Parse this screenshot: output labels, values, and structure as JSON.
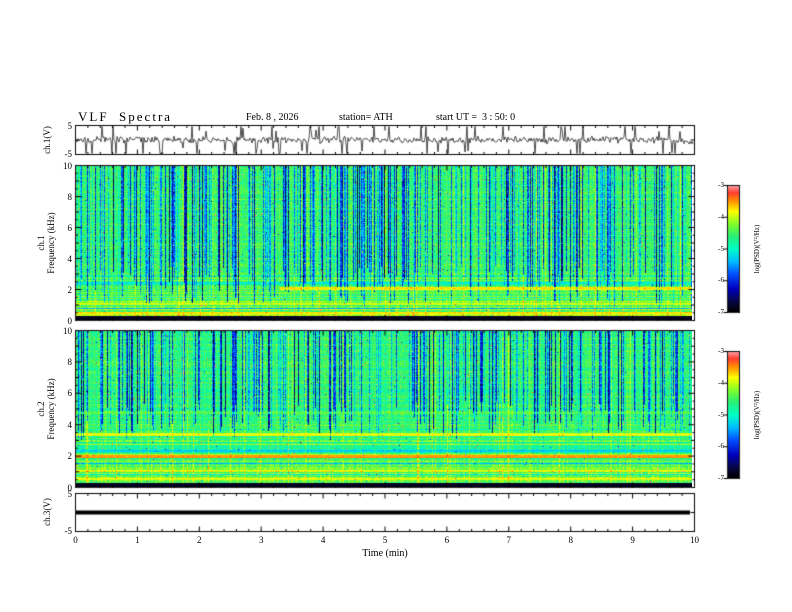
{
  "header": {
    "title": "VLF  Spectra",
    "date": "Feb. 8 , 2026",
    "station": "station= ATH",
    "start_ut": "start UT =  3 : 50: 0"
  },
  "panels": {
    "ch1_waveform": {
      "label": "ch.1(V)",
      "ymax_label": "5",
      "ymin_label": "-5"
    },
    "ch1_spectrogram": {
      "channel_label": "ch.1",
      "axis_label": "Frequency (kHz)",
      "yticks": [
        "10",
        "8",
        "6",
        "4",
        "2",
        "0"
      ]
    },
    "ch2_spectrogram": {
      "channel_label": "ch.2",
      "axis_label": "Frequency (kHz)",
      "yticks": [
        "10",
        "8",
        "6",
        "4",
        "2",
        "0"
      ]
    },
    "ch3_waveform": {
      "label": "ch.3(V)",
      "ymax_label": "5",
      "ymin_label": "-5"
    }
  },
  "colorbar": {
    "label": "log(PSD)(V²/Hz)",
    "ticks": [
      "-3",
      "-4",
      "-5",
      "-6",
      "-7"
    ]
  },
  "xaxis": {
    "label": "Time (min)",
    "ticks": [
      "0",
      "1",
      "2",
      "3",
      "4",
      "5",
      "6",
      "7",
      "8",
      "9",
      "10"
    ]
  },
  "chart_data": [
    {
      "id": "ch1_waveform",
      "type": "line",
      "ylabel": "ch.1(V)",
      "ylim": [
        -5,
        5
      ],
      "xlabel": "Time (min)",
      "xlim": [
        0,
        10
      ],
      "summary": "continuous broadband noise centered on 0 V with dense impulsive spikes reaching about ±5 V across the whole 10 minutes",
      "seed": 5,
      "noise_frac": 0.15,
      "spike_rate": 0.12
    },
    {
      "id": "ch1_spectrogram",
      "type": "heatmap",
      "xlabel": "Time (min)",
      "ylabel": "Frequency (kHz)",
      "zlabel": "log(PSD)(V²/Hz)",
      "xlim": [
        0,
        10
      ],
      "ylim": [
        0,
        10
      ],
      "zlim": [
        -7,
        -3
      ],
      "summary": "green/cyan background near -4.6 with dense dark-blue vertical sferic striations above ~1-3 kHz, scattered red speckles, yellow-orange mottling below 2.5 kHz, red horizontal lines near 0.5/1/2 kHz (the ~2 kHz line strengthens after ~3.3 min) and a black band at 0-0.25 kHz",
      "base_level": -4.55,
      "low_freq_boost": 0.22,
      "streak_density": 0.38,
      "streak_fmin": [
        0.8,
        3.5
      ],
      "stripe": 0,
      "seed": 11,
      "bands": [
        {
          "f": 0.12,
          "hw": 0.14,
          "level": -7.0,
          "s": 0.95
        },
        {
          "f": 0.45,
          "hw": 0.06,
          "level": -3.6,
          "s": 0.7
        },
        {
          "f": 0.75,
          "hw": 0.05,
          "level": -6.3,
          "s": 0.55
        },
        {
          "f": 1.05,
          "hw": 0.06,
          "level": -3.8,
          "s": 0.6
        },
        {
          "f": 1.45,
          "hw": 0.05,
          "level": -6.1,
          "s": 0.45
        },
        {
          "f": 1.8,
          "hw": 0.05,
          "level": -3.9,
          "s": 0.5
        },
        {
          "f": 2.05,
          "hw": 0.08,
          "level": -3.4,
          "s": 0.7,
          "x0": 3.3,
          "x1": 10
        },
        {
          "f": 2.4,
          "hw": 0.05,
          "level": -6.2,
          "s": 0.4
        }
      ]
    },
    {
      "id": "ch2_spectrogram",
      "type": "heatmap",
      "xlabel": "Time (min)",
      "ylabel": "Frequency (kHz)",
      "zlabel": "log(PSD)(V²/Hz)",
      "xlim": [
        0,
        10
      ],
      "ylim": [
        0,
        10
      ],
      "zlim": [
        -7,
        -3
      ],
      "summary": "similar green/cyan background with blue vertical striations mostly above ~4 kHz; lower half dominated by fine horizontal striping with strong red lines near 2 kHz, a yellow-red line near 3.35 kHz, an orange line near 4.75 kHz and a black band at 0-0.25 kHz",
      "base_level": -4.6,
      "low_freq_boost": 0.28,
      "streak_density": 0.3,
      "streak_fmin": [
        3.0,
        5.5
      ],
      "stripe": 0.15,
      "seed": 23,
      "bands": [
        {
          "f": 0.12,
          "hw": 0.14,
          "level": -7.0,
          "s": 0.95
        },
        {
          "f": 0.5,
          "hw": 0.05,
          "level": -3.7,
          "s": 0.65
        },
        {
          "f": 0.8,
          "hw": 0.05,
          "level": -6.2,
          "s": 0.5
        },
        {
          "f": 1.1,
          "hw": 0.05,
          "level": -3.8,
          "s": 0.55
        },
        {
          "f": 1.5,
          "hw": 0.05,
          "level": -6.2,
          "s": 0.45
        },
        {
          "f": 1.95,
          "hw": 0.1,
          "level": -3.2,
          "s": 0.8
        },
        {
          "f": 2.3,
          "hw": 0.05,
          "level": -6.3,
          "s": 0.5
        },
        {
          "f": 2.75,
          "hw": 0.05,
          "level": -4.0,
          "s": 0.4
        },
        {
          "f": 3.35,
          "hw": 0.08,
          "level": -3.5,
          "s": 0.65
        },
        {
          "f": 4.75,
          "hw": 0.07,
          "level": -3.9,
          "s": 0.45
        }
      ]
    },
    {
      "id": "ch3_waveform",
      "type": "line",
      "ylabel": "ch.3(V)",
      "ylim": [
        -5,
        5
      ],
      "xlabel": "Time (min)",
      "xlim": [
        0,
        10
      ],
      "summary": "perfectly flat thick trace at 0 V for the full 10 minutes (channel silent)",
      "value": 0
    }
  ]
}
